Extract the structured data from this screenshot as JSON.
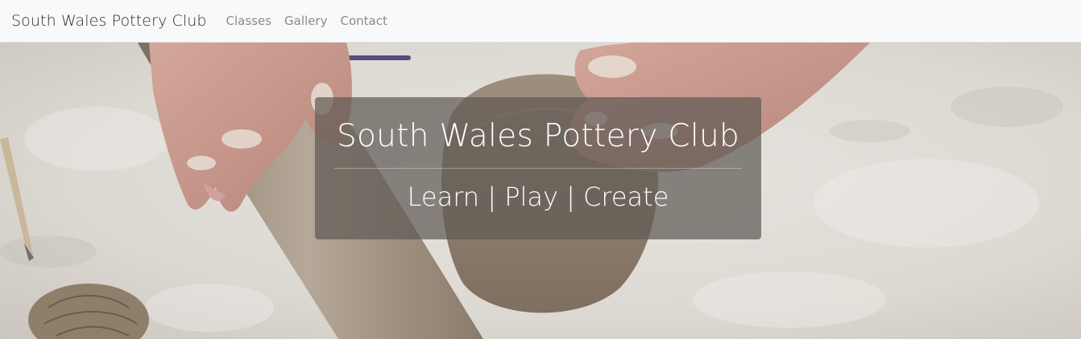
{
  "navbar": {
    "brand": "South Wales Pottery Club",
    "links": [
      {
        "label": "Classes"
      },
      {
        "label": "Gallery"
      },
      {
        "label": "Contact"
      }
    ]
  },
  "hero": {
    "title": "South Wales Pottery Club",
    "subtitle": "Learn | Play | Create",
    "overlay_color": "#605a54"
  },
  "colors": {
    "navbar_bg": "#f8f9fa",
    "brand_text": "#2b2b2b",
    "nav_link_text": "#8a8a8a",
    "clay": "#8c7c6c"
  }
}
